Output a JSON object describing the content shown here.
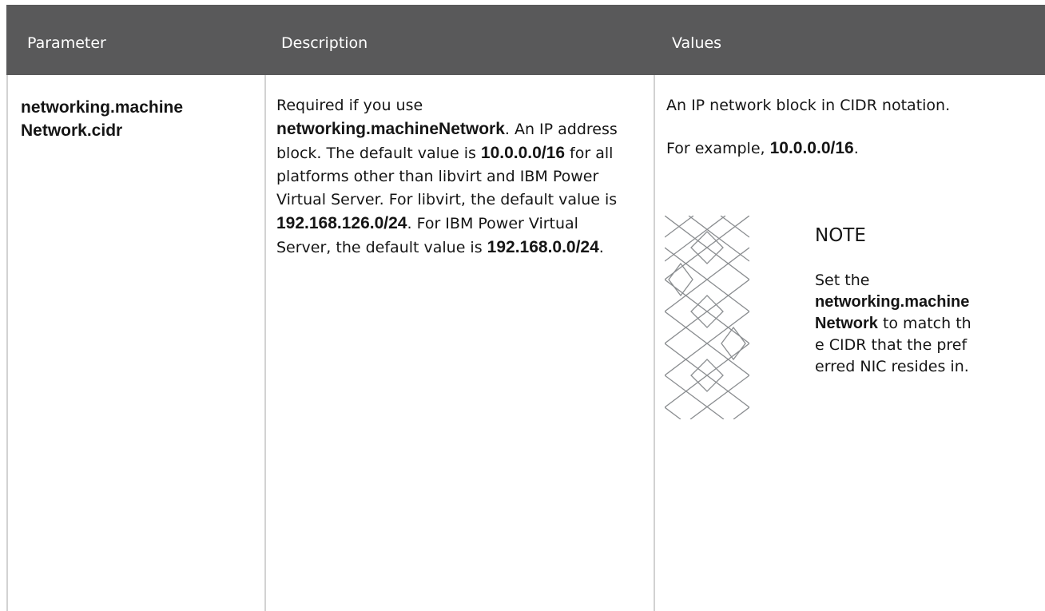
{
  "header": {
    "col_parameter": "Parameter",
    "col_description": "Description",
    "col_values": "Values"
  },
  "row": {
    "parameter": "networking.machineNetwork.cidr",
    "description": {
      "t1": "Required if you use ",
      "b1": "networking.machineNetwork",
      "t2": ". An IP address block. The default value is ",
      "b2": "10.0.0.0/16",
      "t3": " for all platforms other than libvirt and IBM Power Virtual Server. For libvirt, the default value is ",
      "b3": "192.168.126.0/24",
      "t4": ". For IBM Power Virtual Server, the default value is ",
      "b4": "192.168.0.0/24",
      "t5": "."
    },
    "values": {
      "line1": "An IP network block in CIDR notation.",
      "example_prefix": "For example, ",
      "example_value": "10.0.0.0/16",
      "example_suffix": "."
    },
    "note": {
      "title": "NOTE",
      "t1": "Set the ",
      "b1": "networking.machineNetwork",
      "t2": " to match the CIDR that the preferred NIC resides in."
    }
  }
}
